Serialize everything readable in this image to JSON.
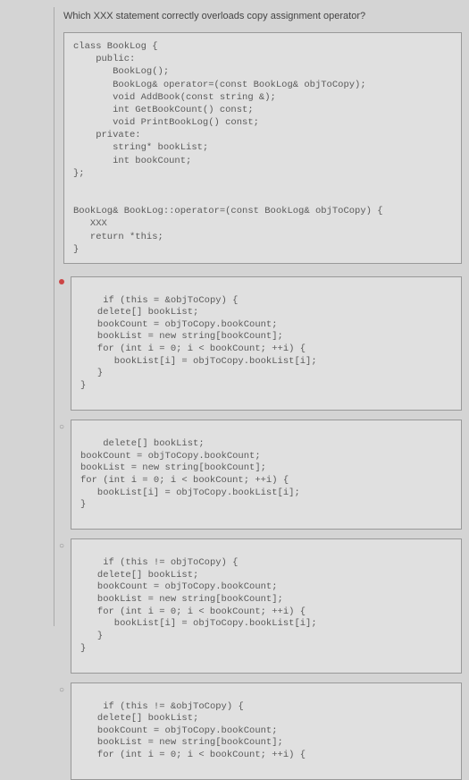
{
  "question": "Which XXX statement correctly overloads copy assignment operator?",
  "classCode": "class BookLog {\n    public:\n       BookLog();\n       BookLog& operator=(const BookLog& objToCopy);\n       void AddBook(const string &);\n       int GetBookCount() const;\n       void PrintBookLog() const;\n    private:\n       string* bookList;\n       int bookCount;\n};\n\n\nBookLog& BookLog::operator=(const BookLog& objToCopy) {\n   XXX\n   return *this;\n}",
  "options": [
    "if (this = &objToCopy) {\n   delete[] bookList;\n   bookCount = objToCopy.bookCount;\n   bookList = new string[bookCount];\n   for (int i = 0; i < bookCount; ++i) {\n      bookList[i] = objToCopy.bookList[i];\n   }\n}",
    "delete[] bookList;\nbookCount = objToCopy.bookCount;\nbookList = new string[bookCount];\nfor (int i = 0; i < bookCount; ++i) {\n   bookList[i] = objToCopy.bookList[i];\n}",
    "if (this != objToCopy) {\n   delete[] bookList;\n   bookCount = objToCopy.bookCount;\n   bookList = new string[bookCount];\n   for (int i = 0; i < bookCount; ++i) {\n      bookList[i] = objToCopy.bookList[i];\n   }\n}",
    "if (this != &objToCopy) {\n   delete[] bookList;\n   bookCount = objToCopy.bookCount;\n   bookList = new string[bookCount];\n   for (int i = 0; i < bookCount; ++i) {"
  ]
}
